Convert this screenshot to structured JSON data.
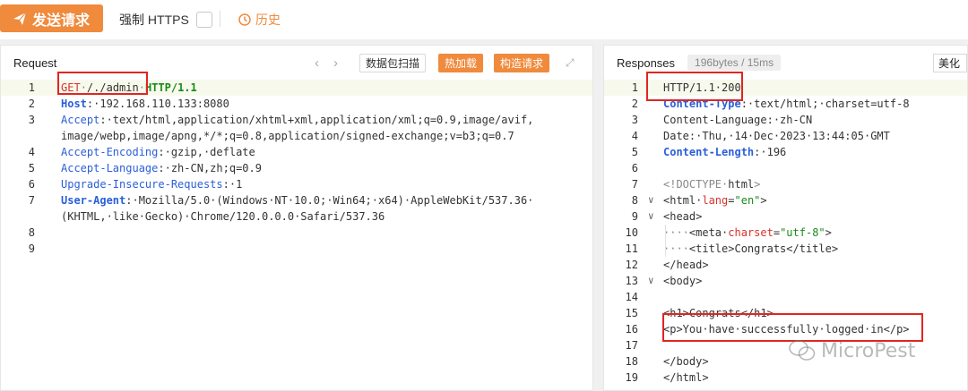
{
  "toolbar": {
    "send_label": "发送请求",
    "https_label": "强制 HTTPS",
    "history_label": "历史",
    "accent": "#f08a3c"
  },
  "request": {
    "title": "Request",
    "scan_label": "数据包扫描",
    "hotload_label": "热加载",
    "build_label": "构造请求",
    "lines": [
      {
        "n": "1",
        "parts": [
          [
            "k-red",
            "GET"
          ],
          [
            "k-gray",
            "·"
          ],
          [
            "",
            "/./admin"
          ],
          [
            "k-gray",
            "·"
          ],
          [
            "k-green k-bold",
            "HTTP/1.1"
          ]
        ]
      },
      {
        "n": "2",
        "parts": [
          [
            "k-blue k-bold",
            "Host"
          ],
          [
            "",
            ":·192.168.110.133:8080"
          ]
        ]
      },
      {
        "n": "3",
        "parts": [
          [
            "k-blue",
            "Accept"
          ],
          [
            "",
            ":·text/html,application/xhtml+xml,application/xml;q=0.9,image/avif,"
          ]
        ]
      },
      {
        "n": "",
        "parts": [
          [
            "",
            "image/webp,image/apng,*/*;q=0.8,application/signed-exchange;v=b3;q=0.7"
          ]
        ]
      },
      {
        "n": "4",
        "parts": [
          [
            "k-blue",
            "Accept-Encoding"
          ],
          [
            "",
            ":·gzip,·deflate"
          ]
        ]
      },
      {
        "n": "5",
        "parts": [
          [
            "k-blue",
            "Accept-Language"
          ],
          [
            "",
            ":·zh-CN,zh;q=0.9"
          ]
        ]
      },
      {
        "n": "6",
        "parts": [
          [
            "k-blue",
            "Upgrade-Insecure-Requests"
          ],
          [
            "",
            ":·1"
          ]
        ]
      },
      {
        "n": "7",
        "parts": [
          [
            "k-blue k-bold",
            "User-Agent"
          ],
          [
            "",
            ":·Mozilla/5.0·(Windows·NT·10.0;·Win64;·x64)·AppleWebKit/537.36·"
          ]
        ]
      },
      {
        "n": "",
        "parts": [
          [
            "",
            "(KHTML,·like·Gecko)·Chrome/120.0.0.0·Safari/537.36"
          ]
        ]
      },
      {
        "n": "8",
        "parts": []
      },
      {
        "n": "9",
        "parts": []
      }
    ]
  },
  "response": {
    "title": "Responses",
    "size_badge": "196bytes / 15ms",
    "beautify_label": "美化",
    "lines": [
      {
        "n": "1",
        "fold": "",
        "parts": [
          [
            "",
            "HTTP/1.1·200"
          ]
        ]
      },
      {
        "n": "2",
        "fold": "",
        "parts": [
          [
            "k-blue k-bold",
            "Content-Type"
          ],
          [
            "",
            ":·text/html;·charset=utf-8"
          ]
        ]
      },
      {
        "n": "3",
        "fold": "",
        "parts": [
          [
            "",
            "Content-Language:·zh-CN"
          ]
        ]
      },
      {
        "n": "4",
        "fold": "",
        "parts": [
          [
            "",
            "Date:·Thu,·14·Dec·2023·13:44:05·GMT"
          ]
        ]
      },
      {
        "n": "5",
        "fold": "",
        "parts": [
          [
            "k-blue k-bold",
            "Content-Length"
          ],
          [
            "",
            ":·196"
          ]
        ]
      },
      {
        "n": "6",
        "fold": "",
        "parts": []
      },
      {
        "n": "7",
        "fold": "",
        "parts": [
          [
            "k-gray",
            "<!DOCTYPE·"
          ],
          [
            "",
            "html"
          ],
          [
            "k-gray",
            ">"
          ]
        ]
      },
      {
        "n": "8",
        "fold": "∨",
        "parts": [
          [
            "",
            "<html·"
          ],
          [
            "k-attr",
            "lang"
          ],
          [
            "",
            "="
          ],
          [
            "k-str",
            "\"en\""
          ],
          [
            "",
            ">"
          ]
        ]
      },
      {
        "n": "9",
        "fold": "∨",
        "parts": [
          [
            "",
            "<head>"
          ]
        ]
      },
      {
        "n": "10",
        "fold": "",
        "parts": [
          [
            "k-gray",
            "····"
          ],
          [
            "",
            "<meta·"
          ],
          [
            "k-attr",
            "charset"
          ],
          [
            "",
            "="
          ],
          [
            "k-str",
            "\"utf-8\""
          ],
          [
            "",
            ">"
          ]
        ]
      },
      {
        "n": "11",
        "fold": "",
        "parts": [
          [
            "k-gray",
            "····"
          ],
          [
            "",
            "<title>Congrats</title>"
          ]
        ]
      },
      {
        "n": "12",
        "fold": "",
        "parts": [
          [
            "",
            "</head>"
          ]
        ]
      },
      {
        "n": "13",
        "fold": "∨",
        "parts": [
          [
            "",
            "<body>"
          ]
        ]
      },
      {
        "n": "14",
        "fold": "",
        "parts": []
      },
      {
        "n": "15",
        "fold": "",
        "parts": [
          [
            "",
            "<h1>Congrats</h1>"
          ]
        ]
      },
      {
        "n": "16",
        "fold": "",
        "parts": [
          [
            "",
            "<p>You·have·successfully·logged·in</p>"
          ]
        ]
      },
      {
        "n": "17",
        "fold": "",
        "parts": []
      },
      {
        "n": "18",
        "fold": "",
        "parts": [
          [
            "",
            "</body>"
          ]
        ]
      },
      {
        "n": "19",
        "fold": "",
        "parts": [
          [
            "",
            "</html>"
          ]
        ]
      }
    ]
  },
  "watermark": "MicroPest"
}
